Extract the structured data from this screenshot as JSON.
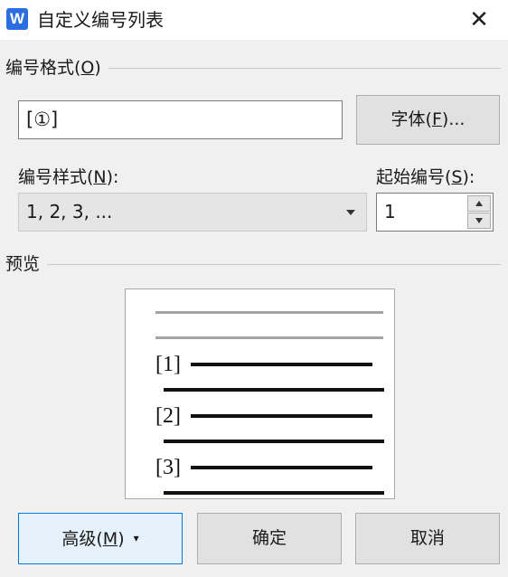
{
  "window": {
    "app_icon_letter": "W",
    "title": "自定义编号列表",
    "close_glyph": "✕"
  },
  "format_group": {
    "label": "编号格式(",
    "accel": "O",
    "label_end": ")",
    "value": "[①]",
    "font_button": {
      "label": "字体(",
      "accel": "F",
      "label_end": ")..."
    }
  },
  "style": {
    "label": "编号样式(",
    "accel": "N",
    "label_end": "):",
    "selected": "1, 2, 3, ..."
  },
  "start": {
    "label": "起始编号(",
    "accel": "S",
    "label_end": "):",
    "value": "1"
  },
  "preview": {
    "label": "预览",
    "numbers": [
      "[1]",
      "[2]",
      "[3]"
    ]
  },
  "buttons": {
    "advanced": {
      "label": "高级(",
      "accel": "M",
      "label_end": ")",
      "arrow": "▾"
    },
    "ok": "确定",
    "cancel": "取消"
  },
  "colors": {
    "accent": "#0078d7",
    "app_icon": "#2b6ee0"
  }
}
